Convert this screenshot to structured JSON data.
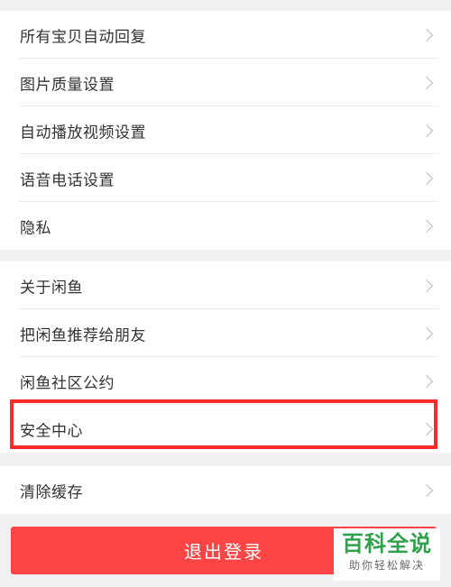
{
  "settings": {
    "group1": [
      {
        "label": "所有宝贝自动回复"
      },
      {
        "label": "图片质量设置"
      },
      {
        "label": "自动播放视频设置"
      },
      {
        "label": "语音电话设置"
      },
      {
        "label": "隐私"
      }
    ],
    "group2": [
      {
        "label": "关于闲鱼"
      },
      {
        "label": "把闲鱼推荐给朋友"
      },
      {
        "label": "闲鱼社区公约"
      },
      {
        "label": "安全中心"
      }
    ],
    "group3": [
      {
        "label": "清除缓存"
      }
    ]
  },
  "logout": {
    "label": "退出登录"
  },
  "watermark": {
    "title": "百科全说",
    "subtitle": "助你轻松解决"
  },
  "colors": {
    "background": "#f1f1f3",
    "logout_button": "#fe4545",
    "highlight_border": "#ff2a2a",
    "watermark_green": "#2ea24b"
  }
}
